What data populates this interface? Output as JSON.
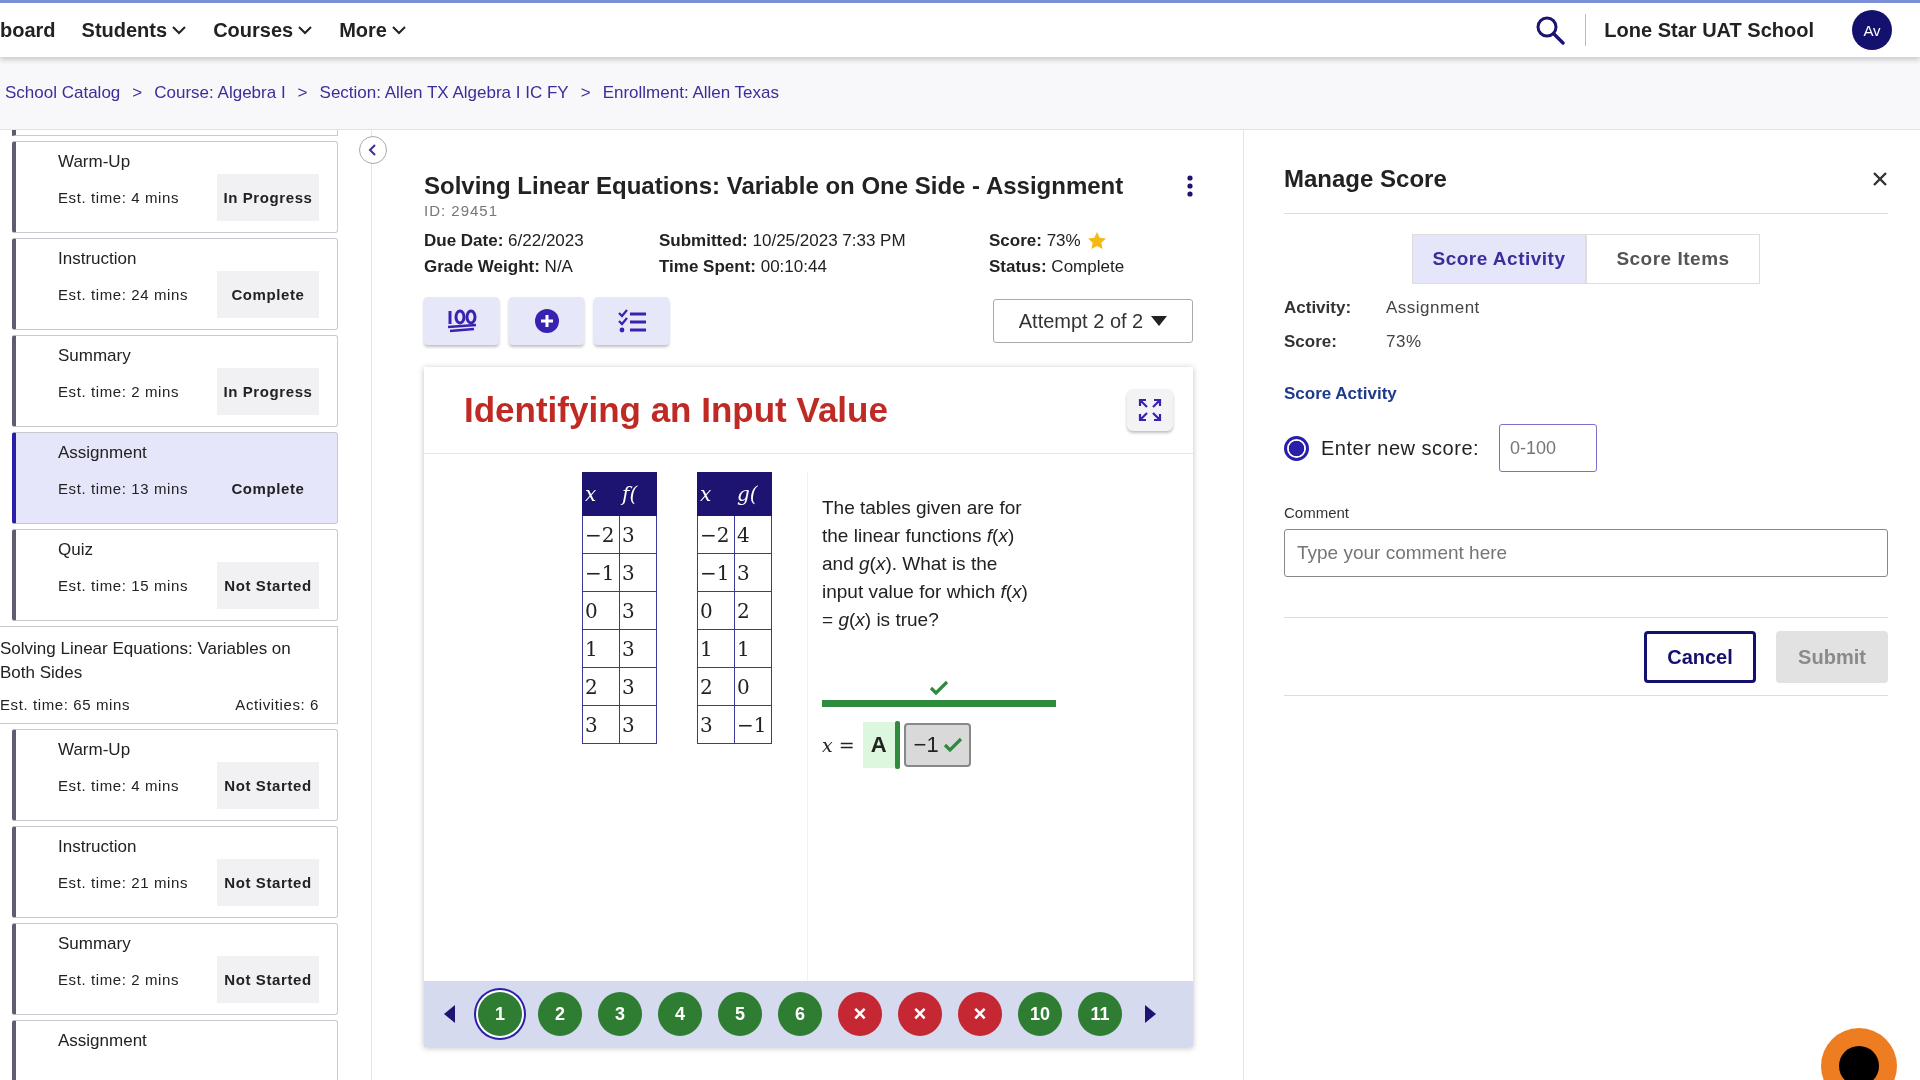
{
  "topnav": {
    "items": [
      {
        "label": "board",
        "has_menu": false
      },
      {
        "label": "Students",
        "has_menu": true
      },
      {
        "label": "Courses",
        "has_menu": true
      },
      {
        "label": "More",
        "has_menu": true
      }
    ],
    "school": "Lone Star UAT School",
    "avatar": "Av"
  },
  "breadcrumbs": [
    {
      "label": "School Catalog"
    },
    {
      "separator": ">",
      "label": "Course: Algebra I"
    },
    {
      "separator": ">",
      "label": "Section: Allen TX Algebra I IC FY"
    },
    {
      "separator": ">",
      "label": "Enrollment: Allen Texas"
    }
  ],
  "sidebar": [
    {
      "kind": "activity",
      "title": "Warm-Up",
      "time": "Est. time: 4 mins",
      "status": "In Progress",
      "selected": false
    },
    {
      "kind": "activity",
      "title": "Instruction",
      "time": "Est. time: 24 mins",
      "status": "Complete",
      "selected": false
    },
    {
      "kind": "activity",
      "title": "Summary",
      "time": "Est. time: 2 mins",
      "status": "In Progress",
      "selected": false
    },
    {
      "kind": "activity",
      "title": "Assignment",
      "time": "Est. time: 13 mins",
      "status": "Complete",
      "selected": true
    },
    {
      "kind": "activity",
      "title": "Quiz",
      "time": "Est. time: 15 mins",
      "status": "Not Started",
      "selected": false
    },
    {
      "kind": "section",
      "title": "Solving Linear Equations: Variables on Both Sides",
      "time": "Est. time: 65 mins",
      "activities": "Activities: 6"
    },
    {
      "kind": "activity",
      "title": "Warm-Up",
      "time": "Est. time: 4 mins",
      "status": "Not Started",
      "selected": false
    },
    {
      "kind": "activity",
      "title": "Instruction",
      "time": "Est. time: 21 mins",
      "status": "Not Started",
      "selected": false
    },
    {
      "kind": "activity",
      "title": "Summary",
      "time": "Est. time: 2 mins",
      "status": "Not Started",
      "selected": false
    },
    {
      "kind": "activity",
      "title": "Assignment",
      "selected": false
    }
  ],
  "assignment": {
    "title": "Solving Linear Equations: Variable on One Side - Assignment",
    "id": "ID: 29451",
    "columns": [
      [
        {
          "label": "Due Date:",
          "value": "6/22/2023"
        },
        {
          "label": "Grade Weight:",
          "value": "N/A"
        }
      ],
      [
        {
          "label": "Submitted:",
          "value": "10/25/2023 7:33 PM"
        },
        {
          "label": "Time Spent:",
          "value": "00:10:44"
        }
      ],
      [
        {
          "label": "Score:",
          "value": "73%",
          "starred": true
        },
        {
          "label": "Status:",
          "value": "Complete"
        }
      ]
    ],
    "tools": [
      {
        "kind": "hundred"
      },
      {
        "kind": "add"
      },
      {
        "kind": "checklist"
      }
    ],
    "attempt": "Attempt 2 of 2"
  },
  "question": {
    "title": "Identifying an Input Value",
    "tables": [
      {
        "headers": [
          "x",
          "f("
        ],
        "rows": [
          [
            "−2",
            "3"
          ],
          [
            "−1",
            "3"
          ],
          [
            "0",
            "3"
          ],
          [
            "1",
            "3"
          ],
          [
            "2",
            "3"
          ],
          [
            "3",
            "3"
          ]
        ]
      },
      {
        "headers": [
          "x",
          "g("
        ],
        "rows": [
          [
            "−2",
            "4"
          ],
          [
            "−1",
            "3"
          ],
          [
            "0",
            "2"
          ],
          [
            "1",
            "1"
          ],
          [
            "2",
            "0"
          ],
          [
            "3",
            "−1"
          ]
        ]
      }
    ],
    "prompt": "The tables given are for the linear functions *f*(*x*) and *g*(*x*). What is the input value for which *f*(*x*) = *g*(*x*) is true?",
    "answer": {
      "lhs": "*x* =",
      "choice": "A",
      "value": "−1",
      "correct": true
    },
    "nav": [
      {
        "label": "1",
        "correct": true,
        "selected": true
      },
      {
        "label": "2",
        "correct": true,
        "selected": false
      },
      {
        "label": "3",
        "correct": true,
        "selected": false
      },
      {
        "label": "4",
        "correct": true,
        "selected": false
      },
      {
        "label": "5",
        "correct": true,
        "selected": false
      },
      {
        "label": "6",
        "correct": true,
        "selected": false
      },
      {
        "label": "×",
        "correct": false,
        "selected": false
      },
      {
        "label": "×",
        "correct": false,
        "selected": false
      },
      {
        "label": "×",
        "correct": false,
        "selected": false
      },
      {
        "label": "10",
        "correct": true,
        "selected": false
      },
      {
        "label": "11",
        "correct": true,
        "selected": false
      }
    ]
  },
  "panel": {
    "title": "Manage Score",
    "tabs": [
      {
        "label": "Score Activity",
        "selected": true
      },
      {
        "label": "Score Items",
        "selected": false
      }
    ],
    "details": [
      {
        "label": "Activity:",
        "value": "Assignment"
      },
      {
        "label": "Score:",
        "value": "73%"
      }
    ],
    "section_title": "Score Activity",
    "option": {
      "label": "Enter new score:",
      "selected": true,
      "placeholder": "0-100"
    },
    "comment": {
      "label": "Comment",
      "placeholder": "Type your comment here"
    },
    "buttons": [
      {
        "label": "Cancel",
        "disabled": false
      },
      {
        "label": "Submit",
        "disabled": true
      }
    ]
  }
}
